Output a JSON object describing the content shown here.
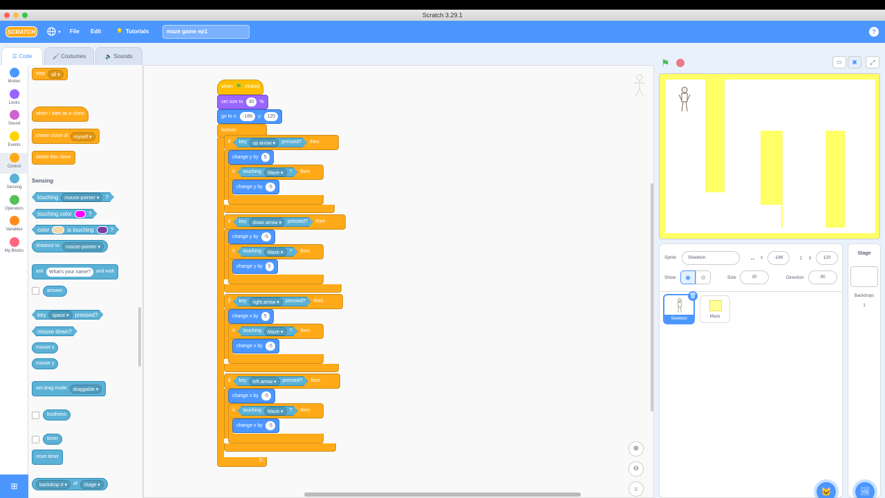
{
  "window": {
    "title": "Scratch 3.29.1"
  },
  "menu": {
    "logo": "SCRATCH",
    "file": "File",
    "edit": "Edit",
    "tutorials": "Tutorials",
    "project_title": "maze game ep1"
  },
  "tabs": {
    "code": "Code",
    "costumes": "Costumes",
    "sounds": "Sounds"
  },
  "categories": [
    {
      "label": "Motion",
      "color": "#4c97ff"
    },
    {
      "label": "Looks",
      "color": "#9966ff"
    },
    {
      "label": "Sound",
      "color": "#cf63cf"
    },
    {
      "label": "Events",
      "color": "#ffd500"
    },
    {
      "label": "Control",
      "color": "#ffab19"
    },
    {
      "label": "Sensing",
      "color": "#5cb1d6"
    },
    {
      "label": "Operators",
      "color": "#59c059"
    },
    {
      "label": "Variables",
      "color": "#ff8c1a"
    },
    {
      "label": "My Blocks",
      "color": "#ff6680"
    }
  ],
  "palette": {
    "stop": "stop",
    "stop_opt": "all",
    "clone_hat": "when I start as a clone",
    "create_clone": "create clone of",
    "create_clone_opt": "myself",
    "delete_clone": "delete this clone",
    "sensing_header": "Sensing",
    "touching": "touching",
    "touching_opt": "mouse-pointer",
    "q": "?",
    "touching_color": "touching color",
    "color": "color",
    "is_touching": "is touching",
    "distance_to": "distance to",
    "distance_opt": "mouse-pointer",
    "ask": "ask",
    "ask_value": "What's your name?",
    "and_wait": "and wait",
    "answer": "answer",
    "key": "key",
    "key_opt": "space",
    "pressed": "pressed?",
    "mouse_down": "mouse down?",
    "mouse_x": "mouse x",
    "mouse_y": "mouse y",
    "set_drag": "set drag mode",
    "drag_opt": "draggable",
    "loudness": "loudness",
    "timer": "timer",
    "reset_timer": "reset timer",
    "backdrop": "backdrop #",
    "of": "of",
    "of_opt": "Stage"
  },
  "script": {
    "when": "when",
    "clicked": "clicked",
    "set_size": "set size to",
    "size_val": "30",
    "pct": "%",
    "goto_x": "go to x:",
    "x_val": "-186",
    "y_lbl": "y:",
    "y_val": "120",
    "forever": "forever",
    "if": "if",
    "then": "then",
    "key": "key",
    "pressed": "pressed?",
    "touching": "touching",
    "maze": "Maze",
    "q": "?",
    "change_y": "change y by",
    "change_x": "change x by",
    "groups": [
      {
        "key": "up arrow",
        "first": "change y by",
        "first_val": "5",
        "second": "change y by",
        "second_val": "-5"
      },
      {
        "key": "down arrow",
        "first": "change y by",
        "first_val": "-5",
        "second": "change y by",
        "second_val": "5"
      },
      {
        "key": "right arrow",
        "first": "change x by",
        "first_val": "5",
        "second": "change x by",
        "second_val": "-5"
      },
      {
        "key": "left arrow",
        "first": "change x by",
        "first_val": "-5",
        "second": "change x by",
        "second_val": "-5"
      }
    ]
  },
  "sprite_info": {
    "sprite_lbl": "Sprite",
    "sprite_name": "Skeleton",
    "x_lbl": "x",
    "x_val": "-186",
    "y_lbl": "y",
    "y_val": "120",
    "show_lbl": "Show",
    "size_lbl": "Size",
    "size_val": "30",
    "dir_lbl": "Direction",
    "dir_val": "90"
  },
  "sprites": [
    {
      "name": "Skeleton"
    },
    {
      "name": "Maze"
    }
  ],
  "stage_panel": {
    "title": "Stage",
    "backdrops_lbl": "Backdrops",
    "backdrops_count": "1"
  },
  "zoom": {
    "reset": "="
  },
  "colors": {
    "accent": "#4c97ff",
    "control": "#ffab19",
    "sensing": "#5cb1d6",
    "stage_bg": "#ffff66"
  }
}
